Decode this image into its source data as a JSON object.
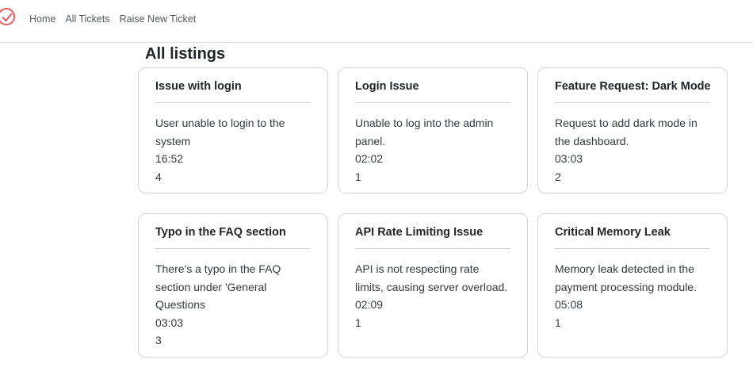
{
  "nav": {
    "links": [
      "Home",
      "All Tickets",
      "Raise New Ticket"
    ]
  },
  "colors": {
    "brand": "#e35d5d"
  },
  "icons": {
    "brand": "check-circle-icon"
  },
  "page": {
    "title": "All listings"
  },
  "tickets": [
    {
      "title": "Issue with login",
      "description": "User unable to login to the system",
      "time": "16:52",
      "count": "4"
    },
    {
      "title": "Login Issue",
      "description": "Unable to log into the admin panel.",
      "time": "02:02",
      "count": "1"
    },
    {
      "title": "Feature Request: Dark Mode",
      "description": "Request to add dark mode in the dashboard.",
      "time": "03:03",
      "count": "2"
    },
    {
      "title": "Typo in the FAQ section",
      "description": "There's a typo in the FAQ section under 'General Questions",
      "time": "03:03",
      "count": "3"
    },
    {
      "title": "API Rate Limiting Issue",
      "description": "API is not respecting rate limits, causing server overload.",
      "time": "02:09",
      "count": "1"
    },
    {
      "title": "Critical Memory Leak",
      "description": "Memory leak detected in the payment processing module.",
      "time": "05:08",
      "count": "1"
    }
  ]
}
